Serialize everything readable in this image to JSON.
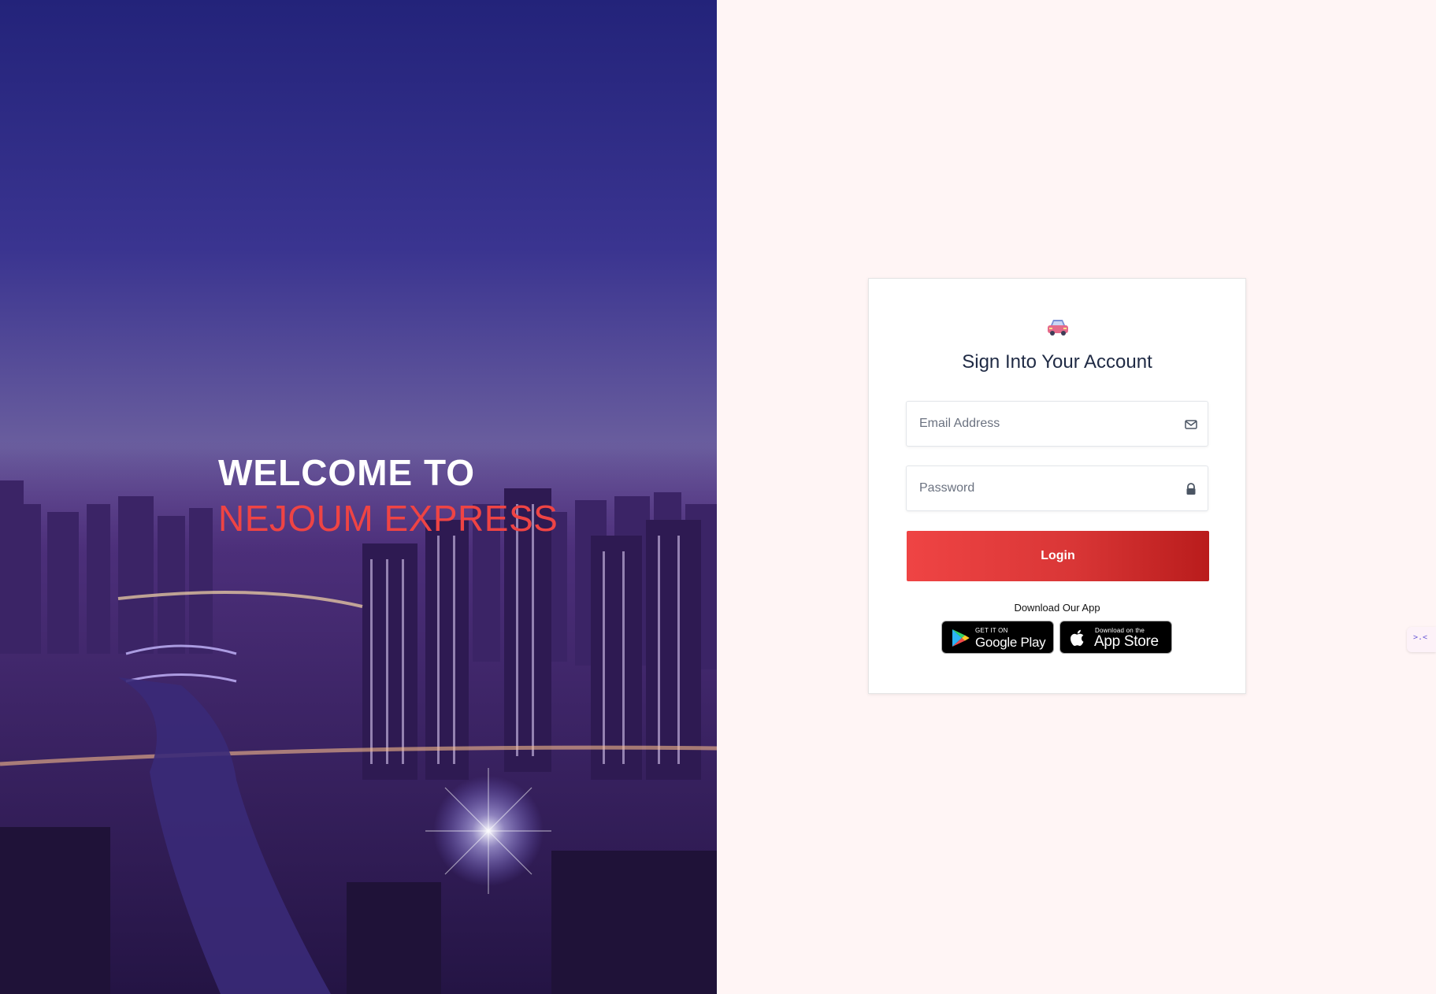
{
  "hero": {
    "welcome": "WELCOME TO",
    "brand": "NEJOUM EXPRESS"
  },
  "login": {
    "logo_icon": "car-icon",
    "title": "Sign Into Your Account",
    "email_placeholder": "Email Address",
    "email_icon": "envelope-icon",
    "password_placeholder": "Password",
    "password_icon": "lock-icon",
    "login_label": "Login",
    "download_label": "Download Our App",
    "google_play": {
      "small": "GET IT ON",
      "big": "Google Play"
    },
    "app_store": {
      "small": "Download on the",
      "big": "App Store"
    }
  },
  "colors": {
    "brand_red": "#ef4444",
    "hero_purple": "#3a3490",
    "page_bg": "#fff5f5"
  }
}
